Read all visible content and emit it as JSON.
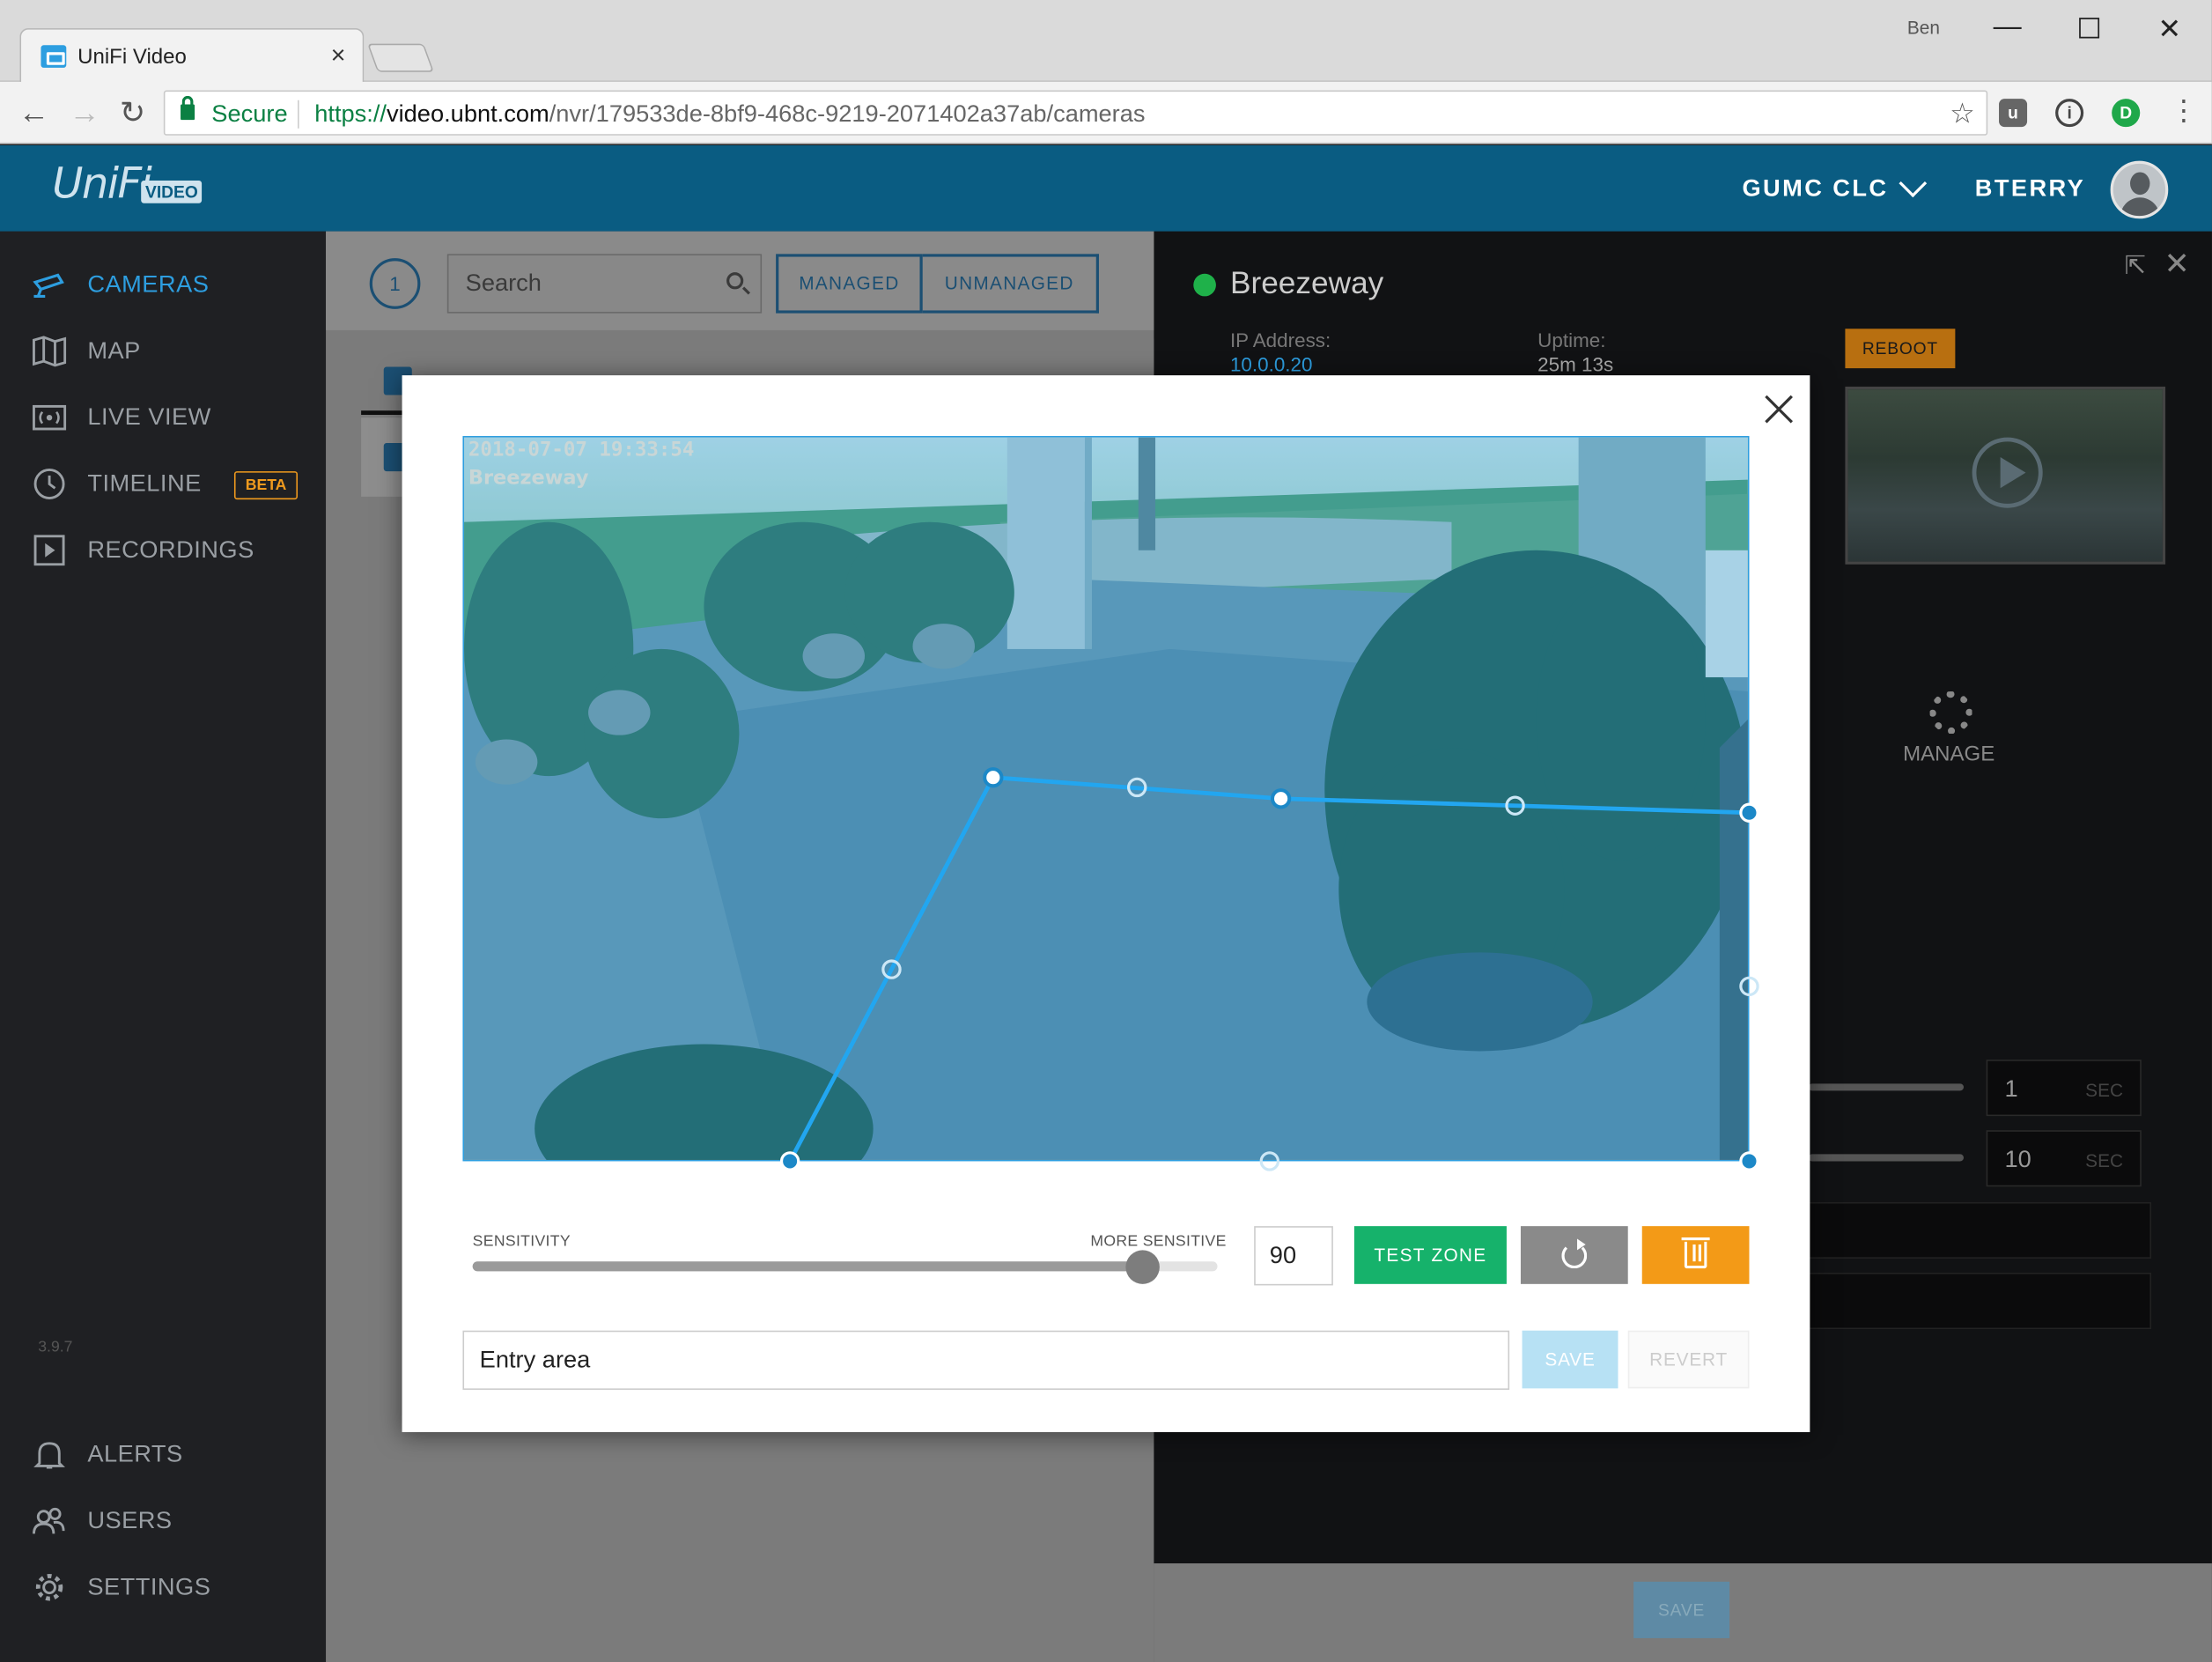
{
  "browser": {
    "tab_title": "UniFi Video",
    "tab_close": "×",
    "window_user": "Ben",
    "secure_label": "Secure",
    "url_proto": "https://",
    "url_host": "video.ubnt.com",
    "url_path": "/nvr/179533de-8bf9-468c-9219-2071402a37ab/cameras"
  },
  "header": {
    "logo": "UniFi",
    "logo_badge": "VIDEO",
    "site": "GUMC CLC",
    "user": "BTERRY"
  },
  "sidebar": {
    "items": [
      {
        "label": "CAMERAS",
        "icon": "camera-icon",
        "active": true
      },
      {
        "label": "MAP",
        "icon": "map-icon"
      },
      {
        "label": "LIVE VIEW",
        "icon": "live-view-icon"
      },
      {
        "label": "TIMELINE",
        "icon": "clock-icon",
        "badge": "BETA"
      },
      {
        "label": "RECORDINGS",
        "icon": "recordings-icon"
      }
    ],
    "version": "3.9.7",
    "bottom_items": [
      {
        "label": "ALERTS",
        "icon": "bell-icon"
      },
      {
        "label": "USERS",
        "icon": "users-icon"
      },
      {
        "label": "SETTINGS",
        "icon": "gear-icon"
      }
    ]
  },
  "camera_list": {
    "count": "1",
    "search_placeholder": "Search",
    "filter_managed": "MANAGED",
    "filter_unmanaged": "UNMANAGED"
  },
  "detail": {
    "camera_name": "Breezeway",
    "ip_label": "IP Address:",
    "ip_value": "10.0.0.20",
    "uptime_label": "Uptime:",
    "uptime_value": "25m 13s",
    "reboot": "REBOOT",
    "manage": "MANAGE",
    "sec1_value": "1",
    "sec2_value": "10",
    "sec_unit": "SEC",
    "save": "SAVE"
  },
  "modal": {
    "osd_timestamp": "2018-07-07 19:33:54",
    "osd_camera": "Breezeway",
    "sensitivity_label": "SENSITIVITY",
    "more_sensitive_label": "MORE SENSITIVE",
    "sensitivity_value": "90",
    "sensitivity_fraction": 0.9,
    "test_zone": "TEST ZONE",
    "zone_name": "Entry area",
    "save": "SAVE",
    "revert": "REVERT"
  },
  "colors": {
    "accent": "#2d9ee0",
    "header": "#0a5c82",
    "test_zone": "#16b26b",
    "delete": "#f39a17",
    "online": "#1fb14a",
    "beta": "#ef9a1e"
  }
}
